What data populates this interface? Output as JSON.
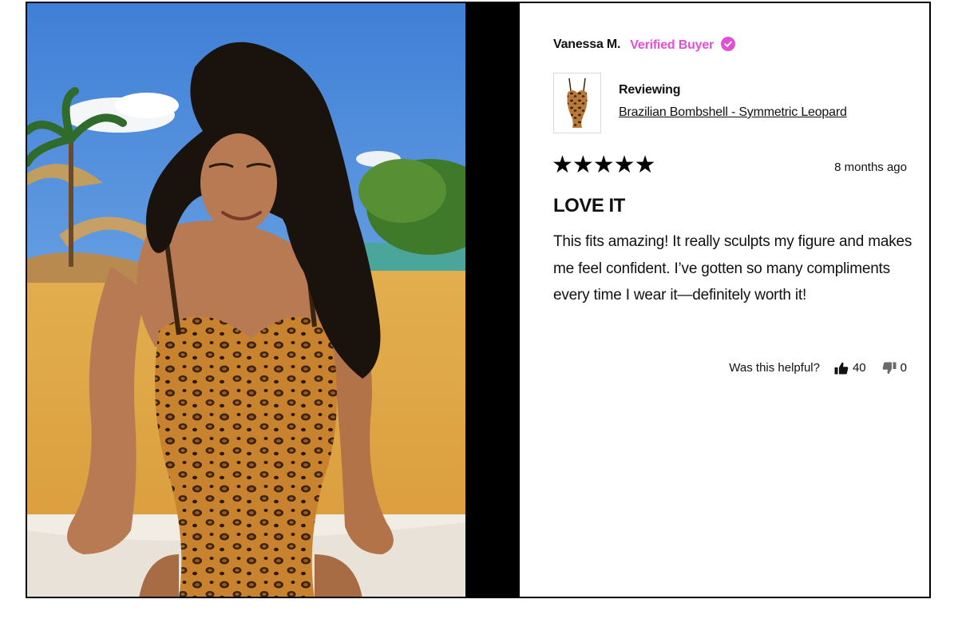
{
  "reviewer": {
    "name": "Vanessa M.",
    "badge": "Verified Buyer",
    "badge_icon": "verified-check-icon",
    "badge_color": "#e14fd2"
  },
  "product": {
    "reviewing_label": "Reviewing",
    "name": "Brazilian Bombshell - Symmetric Leopard"
  },
  "review": {
    "rating": 5,
    "stars": "★★★★★",
    "date": "8 months ago",
    "title": "LOVE IT",
    "body": "This fits amazing! It really sculpts my figure and makes me feel confident. I’ve gotten so many compliments every time I wear it—definitely worth it!"
  },
  "helpful": {
    "question": "Was this helpful?",
    "up_icon": "thumbs-up-icon",
    "up_count": "40",
    "down_icon": "thumbs-down-icon",
    "down_count": "0"
  }
}
